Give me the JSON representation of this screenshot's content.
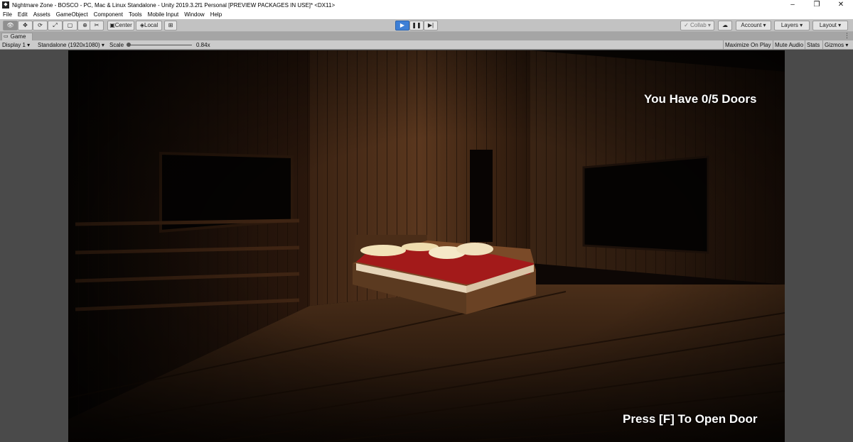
{
  "window": {
    "title": "Nightmare Zone - BOSCO - PC, Mac & Linux Standalone - Unity 2019.3.2f1 Personal [PREVIEW PACKAGES IN USE]* <DX11>",
    "controls": [
      "–",
      "❐",
      "✕"
    ]
  },
  "menu": [
    "File",
    "Edit",
    "Assets",
    "GameObject",
    "Component",
    "Tools",
    "Mobile Input",
    "Window",
    "Help"
  ],
  "toolbar": {
    "pivot_label": "Center",
    "space_label": "Local",
    "collab_label": "Collab",
    "account_label": "Account",
    "layers_label": "Layers",
    "layout_label": "Layout"
  },
  "game_tab": {
    "label": "Game",
    "display": "Display 1",
    "resolution": "Standalone (1920x1080)",
    "scale_label": "Scale",
    "scale_value": "0.84x",
    "maximize_label": "Maximize On Play",
    "mute_label": "Mute Audio",
    "stats_label": "Stats",
    "gizmos_label": "Gizmos"
  },
  "hud": {
    "doors_text": "You Have 0/5 Doors",
    "prompt_text": "Press [F] To Open Door"
  },
  "colors": {
    "play_accent": "#3d7fd6",
    "bed_sheet": "#a31a1a",
    "wood": "#5a3a22"
  }
}
